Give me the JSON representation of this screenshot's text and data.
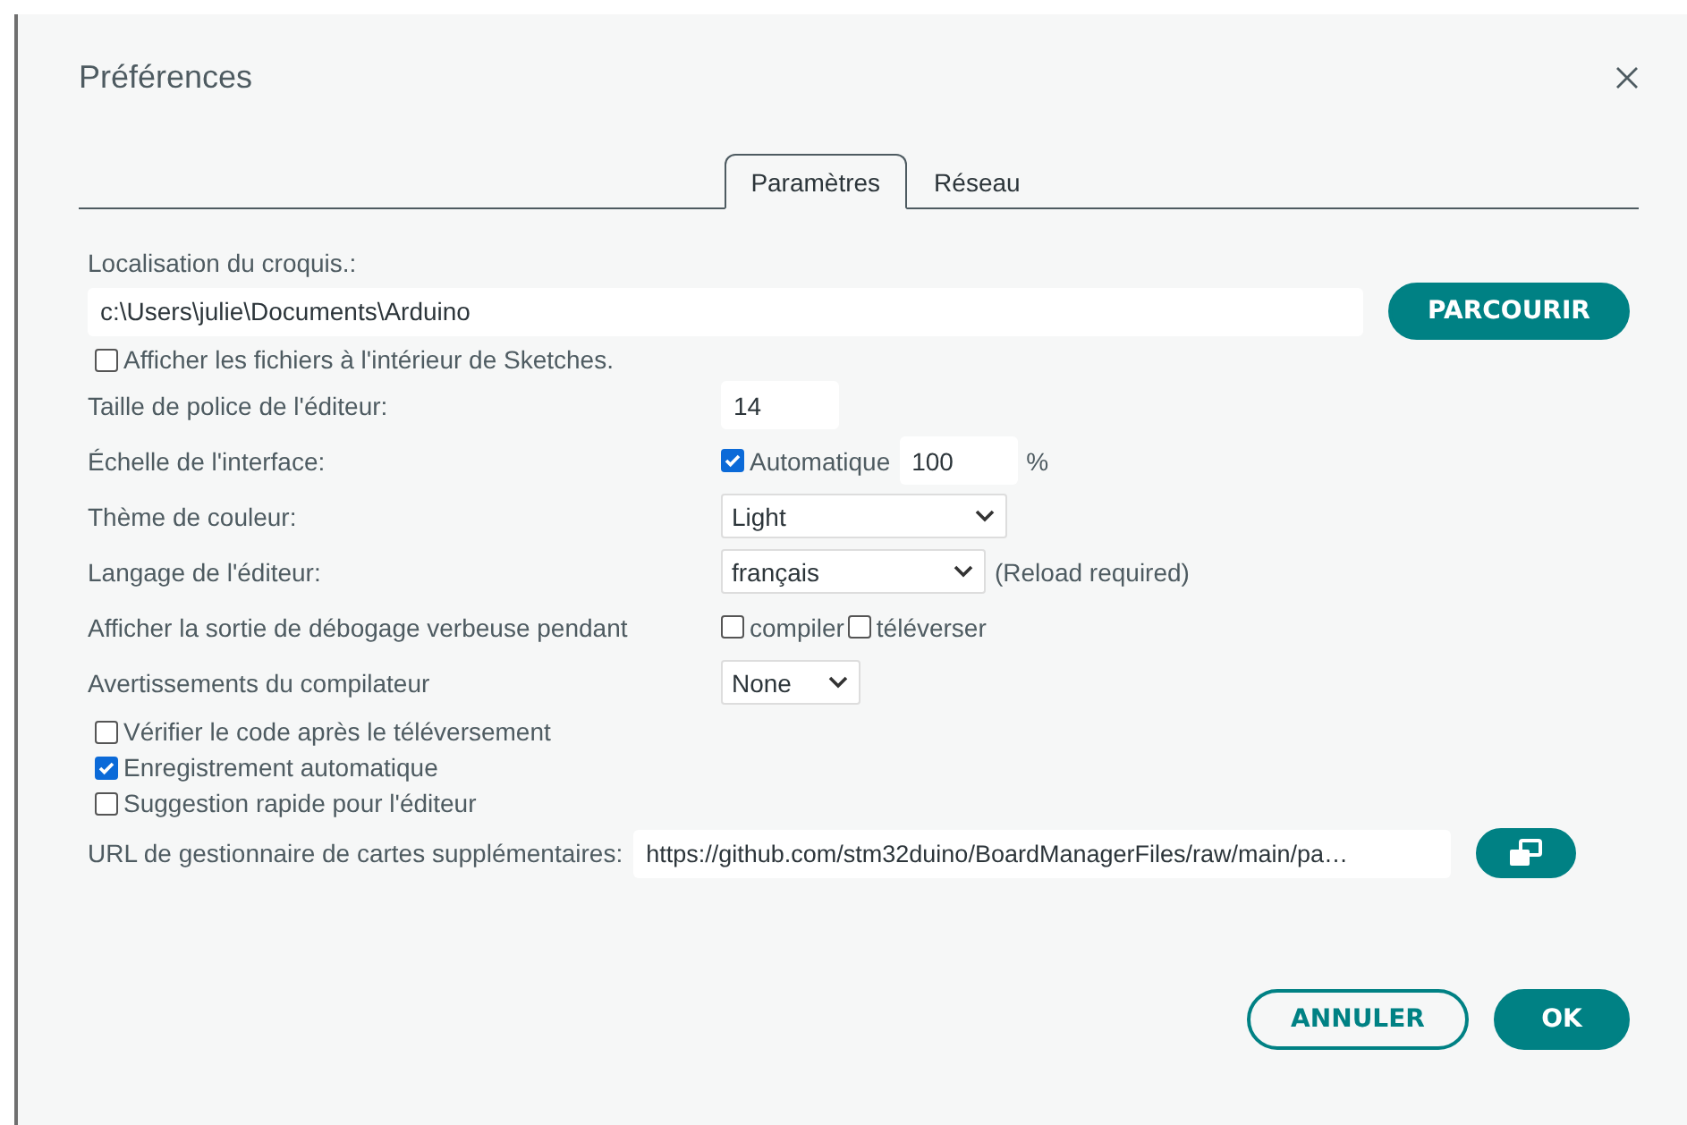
{
  "title": "Préférences",
  "tabs": [
    {
      "label": "Paramètres",
      "selected": true
    },
    {
      "label": "Réseau",
      "selected": false
    }
  ],
  "sketchbook": {
    "label": "Localisation du croquis.:",
    "value": "c:\\Users\\julie\\Documents\\Arduino",
    "button": "PARCOURIR"
  },
  "show_files": {
    "label": "Afficher les fichiers à l'intérieur de Sketches.",
    "checked": false
  },
  "settings": [
    {
      "kind": "text",
      "label": "Taille de police de l'éditeur:",
      "value": "14"
    },
    {
      "kind": "scale",
      "label": "Échelle de l'interface:",
      "auto": {
        "label": "Automatique",
        "checked": true
      },
      "value": "100",
      "unit": "%"
    },
    {
      "kind": "select",
      "label": "Thème de couleur:",
      "value": "Light"
    },
    {
      "kind": "select",
      "label": "Langage de l'éditeur:",
      "value": "français",
      "note": "(Reload required)"
    },
    {
      "kind": "checks",
      "label": "Afficher la sortie de débogage verbeuse pendant",
      "options": [
        {
          "label": "compiler",
          "checked": false
        },
        {
          "label": "téléverser",
          "checked": false
        }
      ]
    },
    {
      "kind": "select",
      "label": "Avertissements du compilateur",
      "value": "None"
    }
  ],
  "options": [
    {
      "label": "Vérifier le code après le téléversement",
      "checked": false
    },
    {
      "label": "Enregistrement automatique",
      "checked": true
    },
    {
      "label": "Suggestion rapide pour l'éditeur",
      "checked": false
    }
  ],
  "urls": {
    "label": "URL de gestionnaire de cartes supplémentaires:",
    "value": "https://github.com/stm32duino/BoardManagerFiles/raw/main/pa…"
  },
  "buttons": [
    {
      "kind": "secondary",
      "label": "ANNULER"
    },
    {
      "kind": "primary",
      "label": "OK"
    }
  ]
}
